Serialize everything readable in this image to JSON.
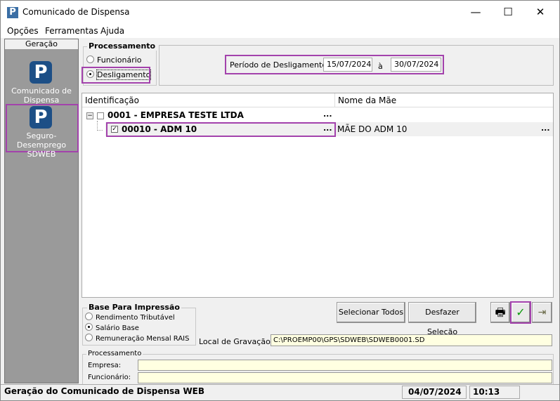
{
  "window": {
    "title": "Comunicado de Dispensa",
    "minimize": "—",
    "maximize": "☐",
    "close": "✕",
    "logo": "P"
  },
  "menu": [
    "Opções",
    "Ferramentas",
    "Ajuda"
  ],
  "sidebar": {
    "header": "Geração",
    "items": [
      {
        "icon": "P",
        "label1": "Comunicado de",
        "label2": "Dispensa"
      },
      {
        "icon": "P",
        "label1": "Seguro-Desemprego",
        "label2": "SDWEB"
      }
    ]
  },
  "processamento": {
    "title": "Processamento",
    "options": [
      "Funcionário",
      "Desligamento"
    ],
    "selected": "Desligamento"
  },
  "periodo": {
    "label": "Período de Desligamento:",
    "start": "15/07/2024",
    "sep": "à",
    "end": "30/07/2024"
  },
  "tree": {
    "columns": [
      "Identificação",
      "Nome da Mãe"
    ],
    "company": {
      "label": "0001 - EMPRESA TESTE LTDA",
      "ellipsis": "...",
      "expander": "−"
    },
    "employees": [
      {
        "label": "00010 - ADM 10",
        "checked": true,
        "ellipsis": "...",
        "mother": "MÃE DO ADM 10",
        "mother_ellipsis": "..."
      }
    ]
  },
  "base": {
    "title": "Base Para Impressão",
    "options": [
      "Rendimento Tributável",
      "Salário Base",
      "Remuneração Mensal RAIS"
    ],
    "selected": "Salário Base"
  },
  "buttons": {
    "select_all": "Selecionar Todos",
    "undo_selection": "Desfazer Seleção",
    "print": "🖶",
    "confirm": "✓",
    "exit": "⇥"
  },
  "local": {
    "label": "Local de Gravação:",
    "value": "C:\\PROEMP00\\GPS\\SDWEB\\SDWEB0001.SD"
  },
  "progress": {
    "title": "Processamento",
    "empresa_label": "Empresa:",
    "empresa_value": "",
    "funcionario_label": "Funcionário:",
    "funcionario_value": ""
  },
  "status": {
    "message": "Geração do Comunicado de Dispensa WEB",
    "date": "04/07/2024",
    "time": "10:13"
  }
}
